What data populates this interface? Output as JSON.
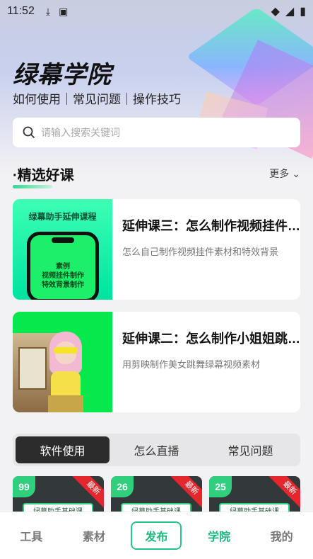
{
  "status": {
    "time": "11:52",
    "icons": [
      "download-icon",
      "a-icon"
    ],
    "right_icons": [
      "wifi-icon",
      "signal-icon",
      "battery-icon"
    ]
  },
  "header": {
    "brand": "绿幕学院",
    "tagline": "如何使用｜常见问题｜操作技巧"
  },
  "search": {
    "placeholder": "请输入搜索关键词"
  },
  "section": {
    "title": "·精选好课",
    "more": "更多"
  },
  "courses": [
    {
      "title": "延伸课三：怎么制作视频挂件素材和特效背景",
      "desc": "怎么自己制作视频挂件素材和特效背景",
      "thumb_title": "绿幕助手延伸课程",
      "thumb_text": [
        "素例",
        "视频挂件制作",
        "特效背景制作"
      ]
    },
    {
      "title": "延伸课二：怎么制作小姐姐跳舞绿幕视频素材",
      "desc": "用剪映制作美女跳舞绿幕视频素材"
    }
  ],
  "tabs": [
    {
      "label": "软件使用",
      "active": true
    },
    {
      "label": "怎么直播"
    },
    {
      "label": "常见问题"
    }
  ],
  "videos": [
    {
      "num": "99",
      "badge": "最新",
      "label": "绿幕助手基础课"
    },
    {
      "num": "26",
      "badge": "最新",
      "label": "绿幕助手基础课"
    },
    {
      "num": "25",
      "badge": "最新",
      "label": "绿幕助手基础课"
    }
  ],
  "nav": [
    {
      "label": "工具"
    },
    {
      "label": "素材"
    },
    {
      "label": "发布"
    },
    {
      "label": "学院"
    },
    {
      "label": "我的"
    }
  ],
  "colors": {
    "accent": "#1db87d",
    "green_screen": "#07e84d"
  }
}
